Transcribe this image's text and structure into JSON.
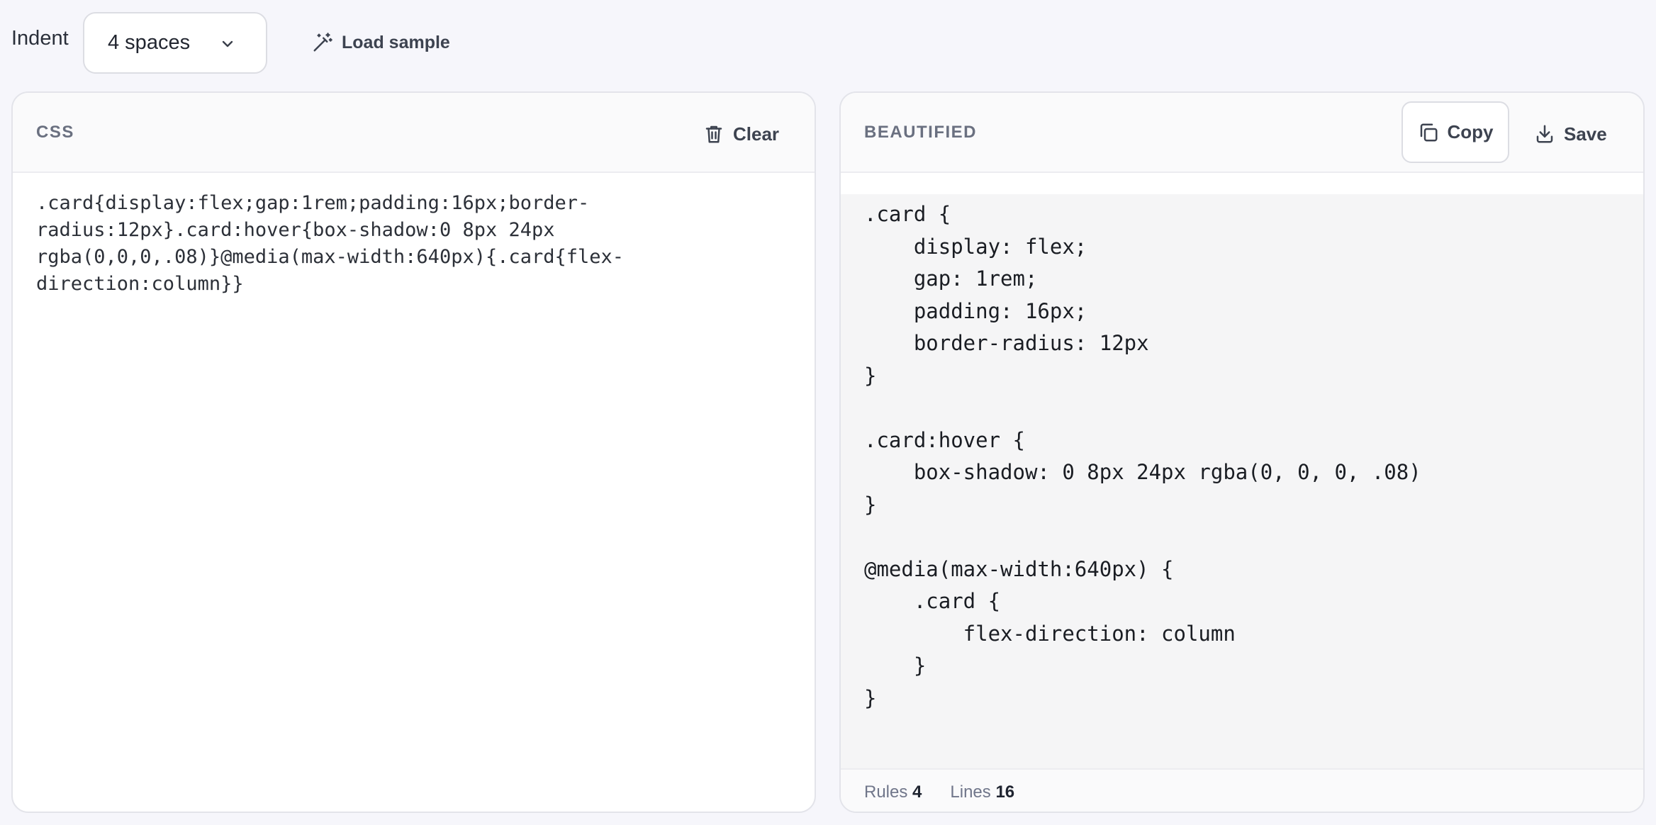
{
  "toolbar": {
    "indent_label": "Indent",
    "indent_value": "4 spaces",
    "load_sample_label": "Load sample"
  },
  "input_panel": {
    "title": "CSS",
    "clear_label": "Clear",
    "content": ".card{display:flex;gap:1rem;padding:16px;border-\nradius:12px}.card:hover{box-shadow:0 8px 24px\nrgba(0,0,0,.08)}@media(max-width:640px){.card{flex-\ndirection:column}}"
  },
  "output_panel": {
    "title": "BEAUTIFIED",
    "copy_label": "Copy",
    "save_label": "Save",
    "content": ".card {\n    display: flex;\n    gap: 1rem;\n    padding: 16px;\n    border-radius: 12px\n}\n\n.card:hover {\n    box-shadow: 0 8px 24px rgba(0, 0, 0, .08)\n}\n\n@media(max-width:640px) {\n    .card {\n        flex-direction: column\n    }\n}"
  },
  "status": {
    "rules_label": "Rules",
    "rules_value": "4",
    "lines_label": "Lines",
    "lines_value": "16"
  },
  "icons": {
    "indent_dropdown": "chevron-down-icon",
    "load_sample": "magic-wand-icon",
    "clear": "trash-icon",
    "copy": "copy-icon",
    "save": "download-icon"
  }
}
